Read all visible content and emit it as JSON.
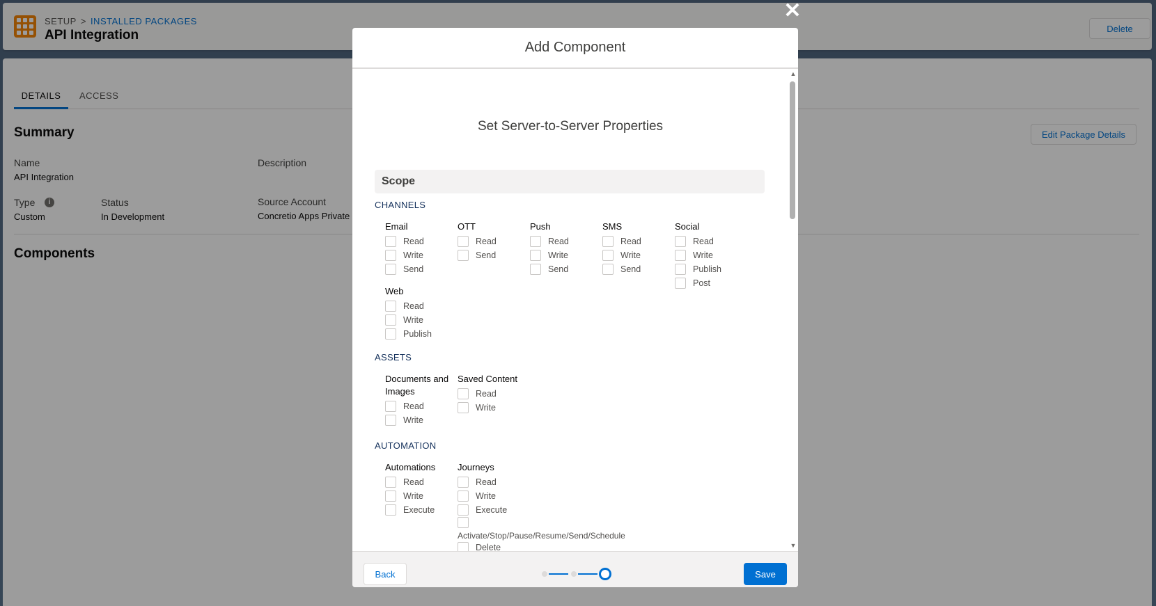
{
  "header": {
    "breadcrumb": [
      "SETUP",
      "INSTALLED PACKAGES"
    ],
    "breadcrumb_sep": ">",
    "title": "API Integration",
    "delete_label": "Delete"
  },
  "tabs": [
    {
      "label": "DETAILS",
      "active": true
    },
    {
      "label": "ACCESS",
      "active": false
    }
  ],
  "summary": {
    "heading": "Summary",
    "edit_label": "Edit Package Details",
    "name_label": "Name",
    "name_value": "API Integration",
    "description_label": "Description",
    "type_label": "Type",
    "type_value": "Custom",
    "status_label": "Status",
    "status_value": "In Development",
    "source_label": "Source Account",
    "source_value": "Concretio Apps Private"
  },
  "components_heading": "Components",
  "modal": {
    "title": "Add Component",
    "close_icon": "close-icon",
    "step_title": "Set Server-to-Server Properties",
    "scope_label": "Scope",
    "sections": [
      {
        "label": "CHANNELS",
        "groups": [
          {
            "title": "Email",
            "options": [
              "Read",
              "Write",
              "Send"
            ]
          },
          {
            "title": "OTT",
            "options": [
              "Read",
              "Send"
            ]
          },
          {
            "title": "Push",
            "options": [
              "Read",
              "Write",
              "Send"
            ]
          },
          {
            "title": "SMS",
            "options": [
              "Read",
              "Write",
              "Send"
            ]
          },
          {
            "title": "Social",
            "options": [
              "Read",
              "Write",
              "Publish",
              "Post"
            ]
          },
          {
            "title": "Web",
            "options": [
              "Read",
              "Write",
              "Publish"
            ]
          }
        ]
      },
      {
        "label": "ASSETS",
        "groups": [
          {
            "title": "Documents and Images",
            "options": [
              "Read",
              "Write"
            ]
          },
          {
            "title": "Saved Content",
            "options": [
              "Read",
              "Write"
            ]
          }
        ]
      },
      {
        "label": "AUTOMATION",
        "groups": [
          {
            "title": "Automations",
            "options": [
              "Read",
              "Write",
              "Execute"
            ]
          },
          {
            "title": "Journeys",
            "options": [
              "Read",
              "Write",
              "Execute",
              "Activate/Stop/Pause/Resume/Send/Schedule",
              "Delete"
            ]
          }
        ]
      }
    ],
    "footer": {
      "back_label": "Back",
      "save_label": "Save",
      "steps_total": 3,
      "current_step": 3
    }
  },
  "colors": {
    "brand_blue": "#0070d2",
    "app_icon_orange": "#f38303"
  }
}
